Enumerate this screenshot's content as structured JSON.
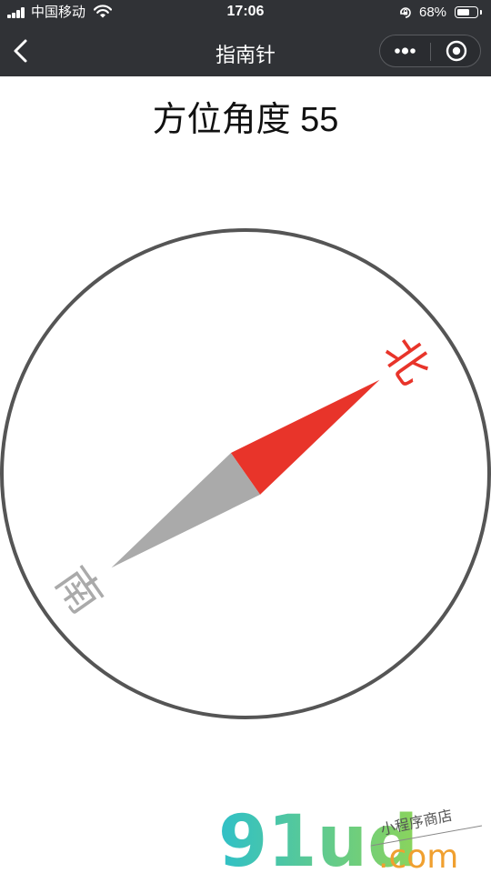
{
  "status_bar": {
    "carrier": "中国移动",
    "time": "17:06",
    "battery_percent": "68%",
    "battery_level": 0.68,
    "signal_icon": "cellular-signal-icon",
    "wifi_icon": "wifi-icon",
    "lock_icon": "orientation-lock-icon"
  },
  "nav": {
    "title": "指南针",
    "back_icon": "chevron-left-icon",
    "more_icon": "more-dots-icon",
    "close_icon": "miniprogram-close-icon"
  },
  "heading": {
    "label": "方位角度",
    "value": "55"
  },
  "compass": {
    "azimuth_deg": 55,
    "north_label": "北",
    "south_label": "南",
    "colors": {
      "north": "#e8342a",
      "south": "#aaaaaa",
      "ring": "#555555"
    }
  },
  "watermark": {
    "logo_text": "91ud",
    "domain": ".com",
    "tagline": "小程序商店"
  }
}
